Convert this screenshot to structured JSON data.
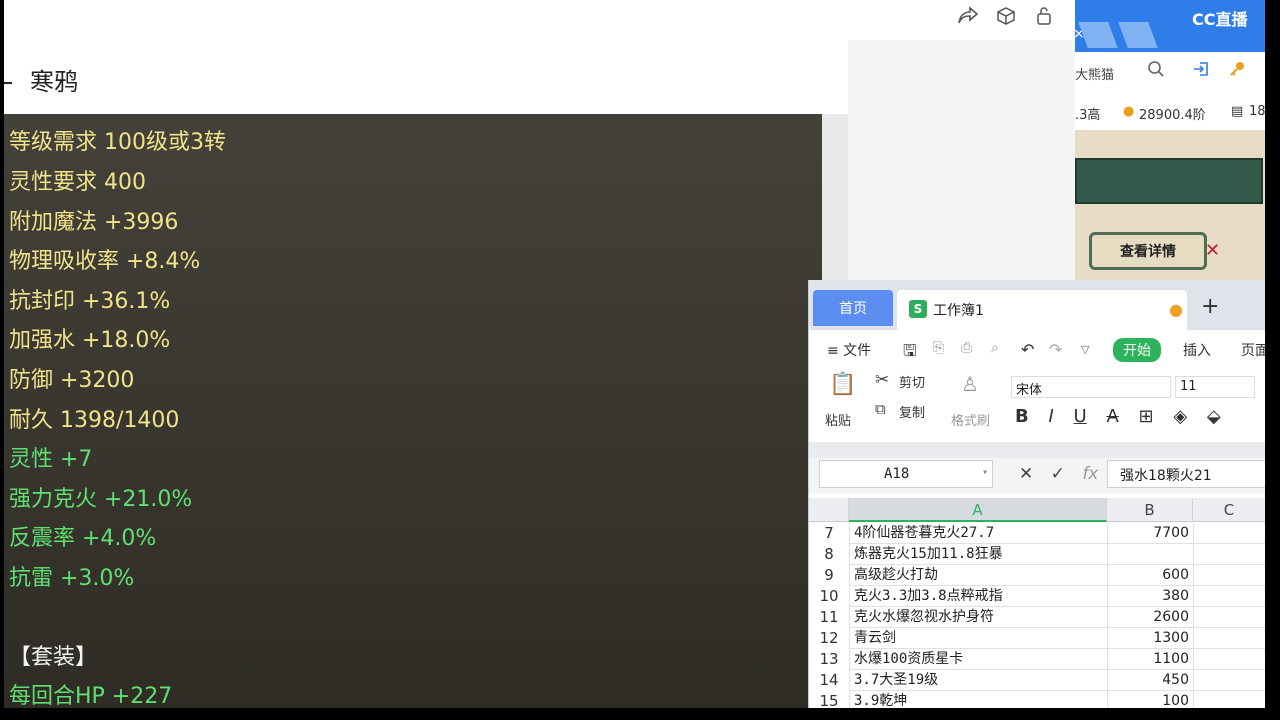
{
  "header": {
    "title": "寒鸦",
    "icons": [
      "share-icon",
      "cube-icon",
      "lock-icon"
    ]
  },
  "stats": [
    {
      "text": "等级需求 100级或3转",
      "color": "yellow"
    },
    {
      "text": "灵性要求 400",
      "color": "yellow"
    },
    {
      "text": "附加魔法 +3996",
      "color": "yellow"
    },
    {
      "text": "物理吸收率 +8.4%",
      "color": "yellow"
    },
    {
      "text": "抗封印 +36.1%",
      "color": "yellow"
    },
    {
      "text": "加强水 +18.0%",
      "color": "yellow"
    },
    {
      "text": "防御 +3200",
      "color": "yellow"
    },
    {
      "text": "耐久 1398/1400",
      "color": "yellow"
    },
    {
      "text": "灵性 +7",
      "color": "green"
    },
    {
      "text": "强力克火 +21.0%",
      "color": "green"
    },
    {
      "text": "反震率 +4.0%",
      "color": "green"
    },
    {
      "text": "抗雷 +3.0%",
      "color": "green"
    },
    {
      "text": "【套装】",
      "color": "white"
    },
    {
      "text": "每回合HP +227",
      "color": "green"
    }
  ],
  "browser": {
    "logo": "CC直播",
    "search_text": "大熊猫",
    "stock1": ".3高",
    "stock2": "28900.4阶",
    "stock3": "18",
    "game_button": "查看详情"
  },
  "sheet": {
    "home_tab": "首页",
    "doc_icon": "S",
    "doc_name": "工作簿1",
    "menu": {
      "hamburger": "≡ 文件",
      "start": "开始",
      "insert": "插入",
      "page": "页面"
    },
    "ribbon": {
      "paste": "粘贴",
      "cut": "剪切",
      "copy": "复制",
      "format_painter": "格式刷"
    },
    "font_name": "宋体",
    "font_size": "11",
    "cell_ref": "A18",
    "formula_value": "强水18颗火21",
    "fx": "fx",
    "columns": [
      "A",
      "B",
      "C"
    ],
    "rows": [
      {
        "n": "7",
        "a": "4阶仙器苍暮克火27.7",
        "b": "7700"
      },
      {
        "n": "8",
        "a": "炼器克火15加11.8狂暴",
        "b": ""
      },
      {
        "n": "9",
        "a": "高级趁火打劫",
        "b": "600"
      },
      {
        "n": "10",
        "a": "克火3.3加3.8点粹戒指",
        "b": "380"
      },
      {
        "n": "11",
        "a": "克火水爆忽视水护身符",
        "b": "2600"
      },
      {
        "n": "12",
        "a": "青云剑",
        "b": "1300"
      },
      {
        "n": "13",
        "a": "水爆100资质星卡",
        "b": "1100"
      },
      {
        "n": "14",
        "a": "3.7大圣19级",
        "b": "450"
      },
      {
        "n": "15",
        "a": "3.9乾坤",
        "b": "100"
      }
    ]
  }
}
